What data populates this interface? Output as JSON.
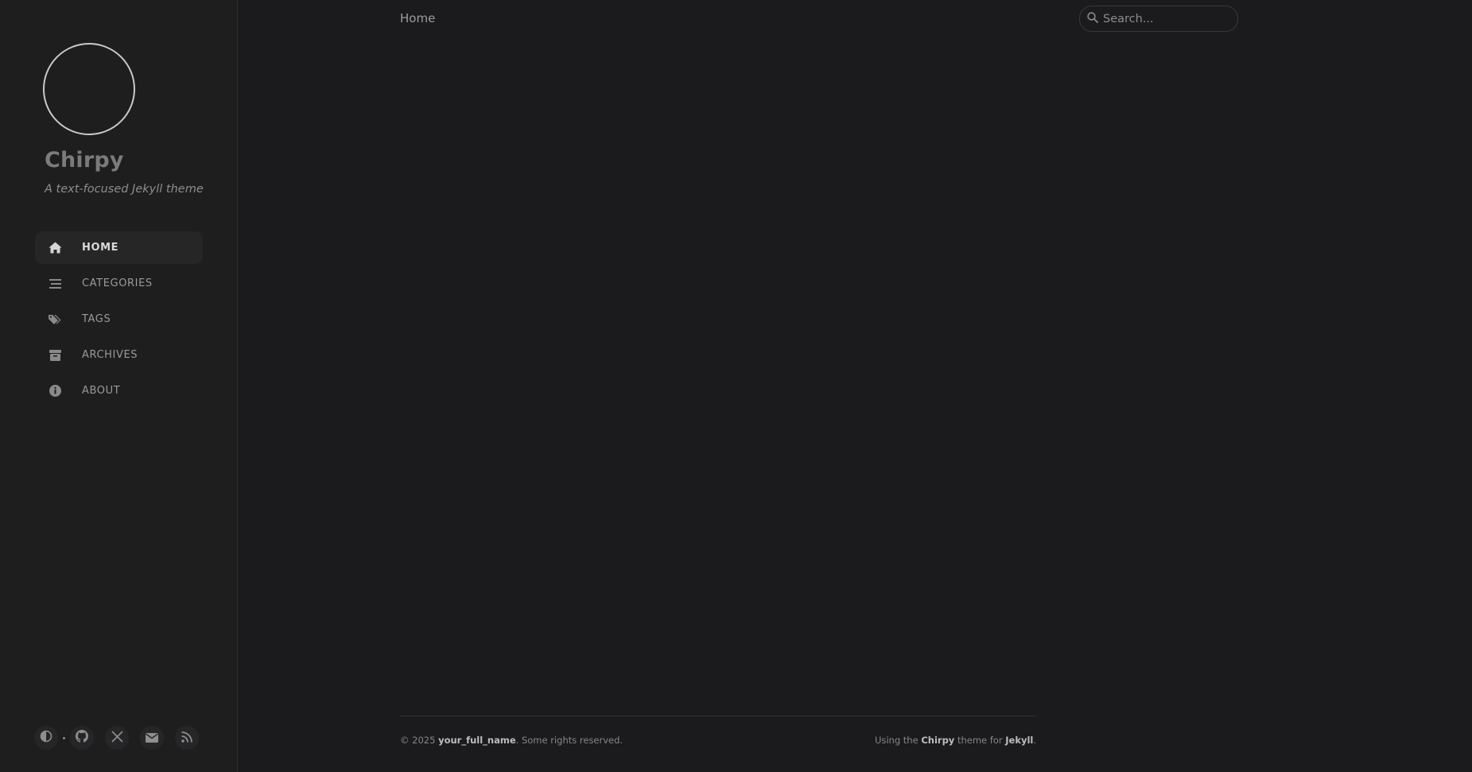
{
  "sidebar": {
    "site_title": "Chirpy",
    "site_subtitle": "A text-focused Jekyll theme",
    "nav": [
      {
        "label": "HOME",
        "icon": "home-icon",
        "active": true
      },
      {
        "label": "CATEGORIES",
        "icon": "stream-icon",
        "active": false
      },
      {
        "label": "TAGS",
        "icon": "tags-icon",
        "active": false
      },
      {
        "label": "ARCHIVES",
        "icon": "archive-icon",
        "active": false
      },
      {
        "label": "ABOUT",
        "icon": "info-circle-icon",
        "active": false
      }
    ],
    "bottom_icons": [
      "theme-toggle-icon",
      "github-icon",
      "x-twitter-icon",
      "email-icon",
      "rss-icon"
    ]
  },
  "topbar": {
    "breadcrumb": "Home",
    "search_placeholder": "Search..."
  },
  "footer": {
    "left_prefix": "© 2025 ",
    "author": "your_full_name",
    "left_suffix": ". Some rights reserved.",
    "right_prefix": "Using the ",
    "theme_name": "Chirpy",
    "right_middle": " theme for ",
    "engine": "Jekyll",
    "right_suffix": "."
  },
  "colors": {
    "background": "#1b1b1e",
    "sidebar_bg": "#1e1e1e",
    "active_nav_bg": "#262626"
  }
}
